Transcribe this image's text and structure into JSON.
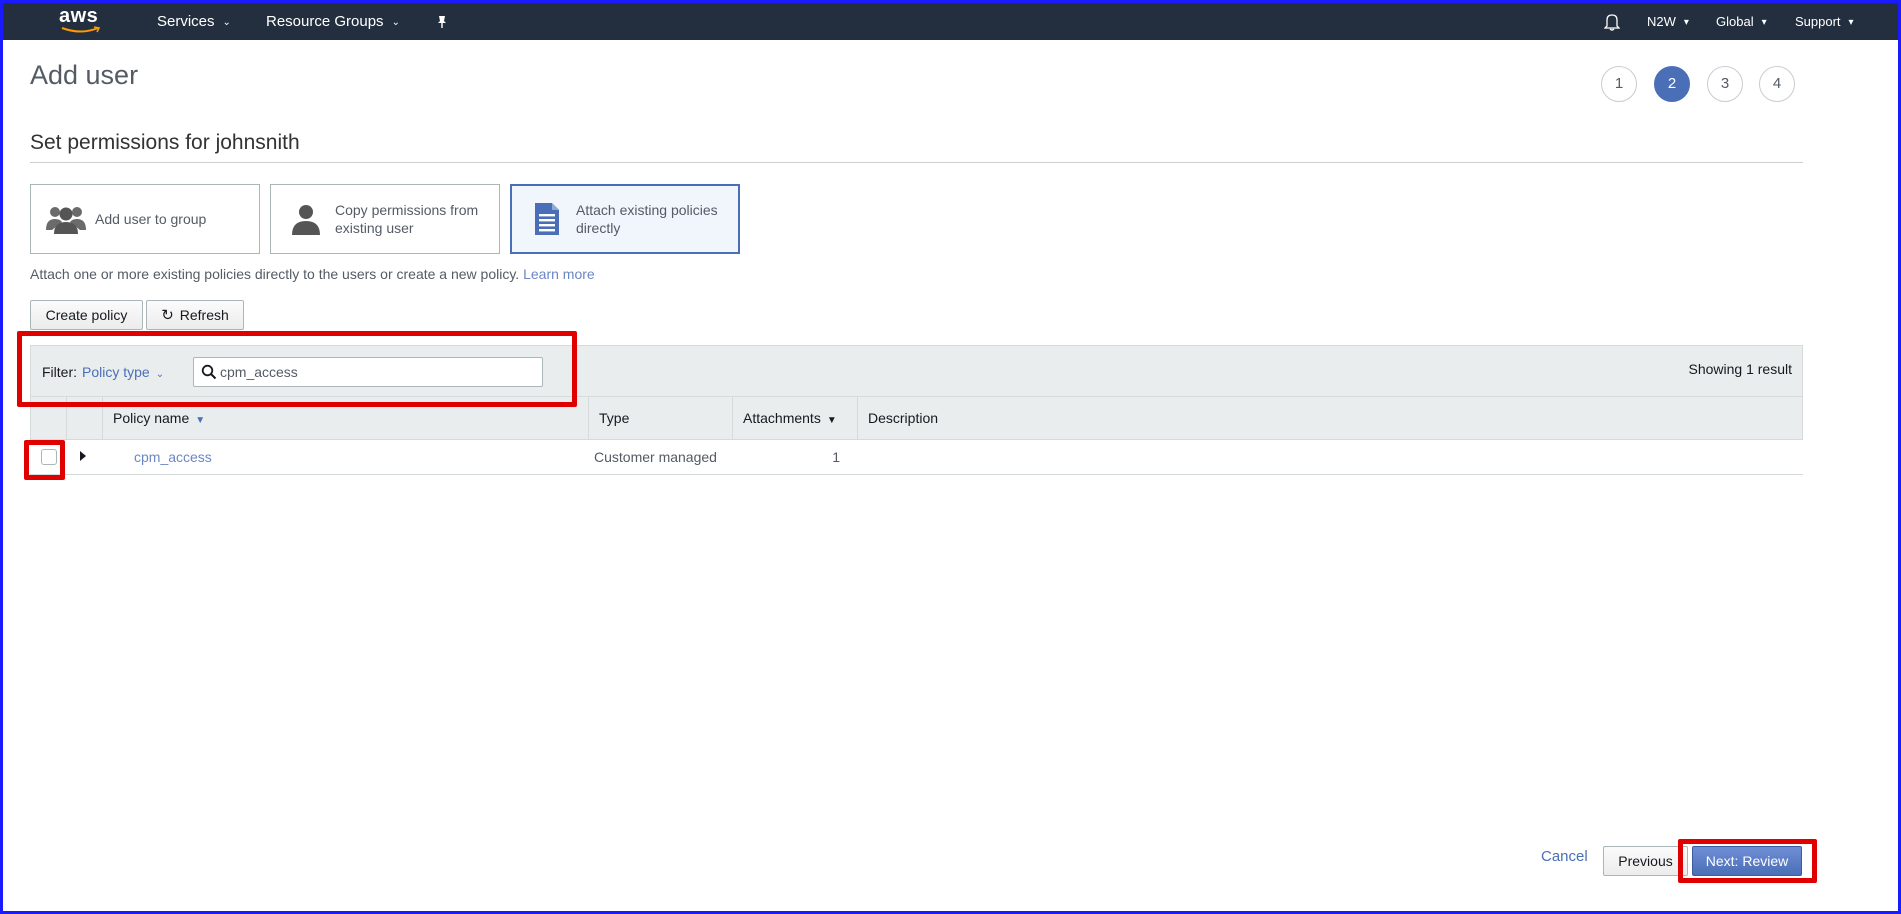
{
  "topnav": {
    "logo_text": "aws",
    "services": "Services",
    "resource_groups": "Resource Groups",
    "account": "N2W",
    "region": "Global",
    "support": "Support"
  },
  "page": {
    "title": "Add user",
    "steps": [
      "1",
      "2",
      "3",
      "4"
    ],
    "active_step": 2,
    "section_title": "Set permissions for johnsnith"
  },
  "options": [
    {
      "label": "Add user to group",
      "icon": "group-icon"
    },
    {
      "label": "Copy permissions from existing user",
      "icon": "user-icon"
    },
    {
      "label": "Attach existing policies directly",
      "icon": "document-icon",
      "selected": true
    }
  ],
  "helper": {
    "text": "Attach one or more existing policies directly to the users or create a new policy.",
    "link": "Learn more"
  },
  "actions": {
    "create_policy": "Create policy",
    "refresh": "Refresh"
  },
  "filter": {
    "label": "Filter:",
    "type": "Policy type",
    "search_value": "cpm_access",
    "result_count": "Showing 1 result"
  },
  "table": {
    "columns": [
      "Policy name",
      "Type",
      "Attachments",
      "Description"
    ],
    "rows": [
      {
        "name": "cpm_access",
        "type": "Customer managed",
        "attachments": "1",
        "description": ""
      }
    ]
  },
  "footer": {
    "cancel": "Cancel",
    "previous": "Previous",
    "next": "Next: Review"
  },
  "colors": {
    "nav_bg": "#232f3e",
    "accent": "#4a6fb6",
    "callout": "#e00000"
  }
}
